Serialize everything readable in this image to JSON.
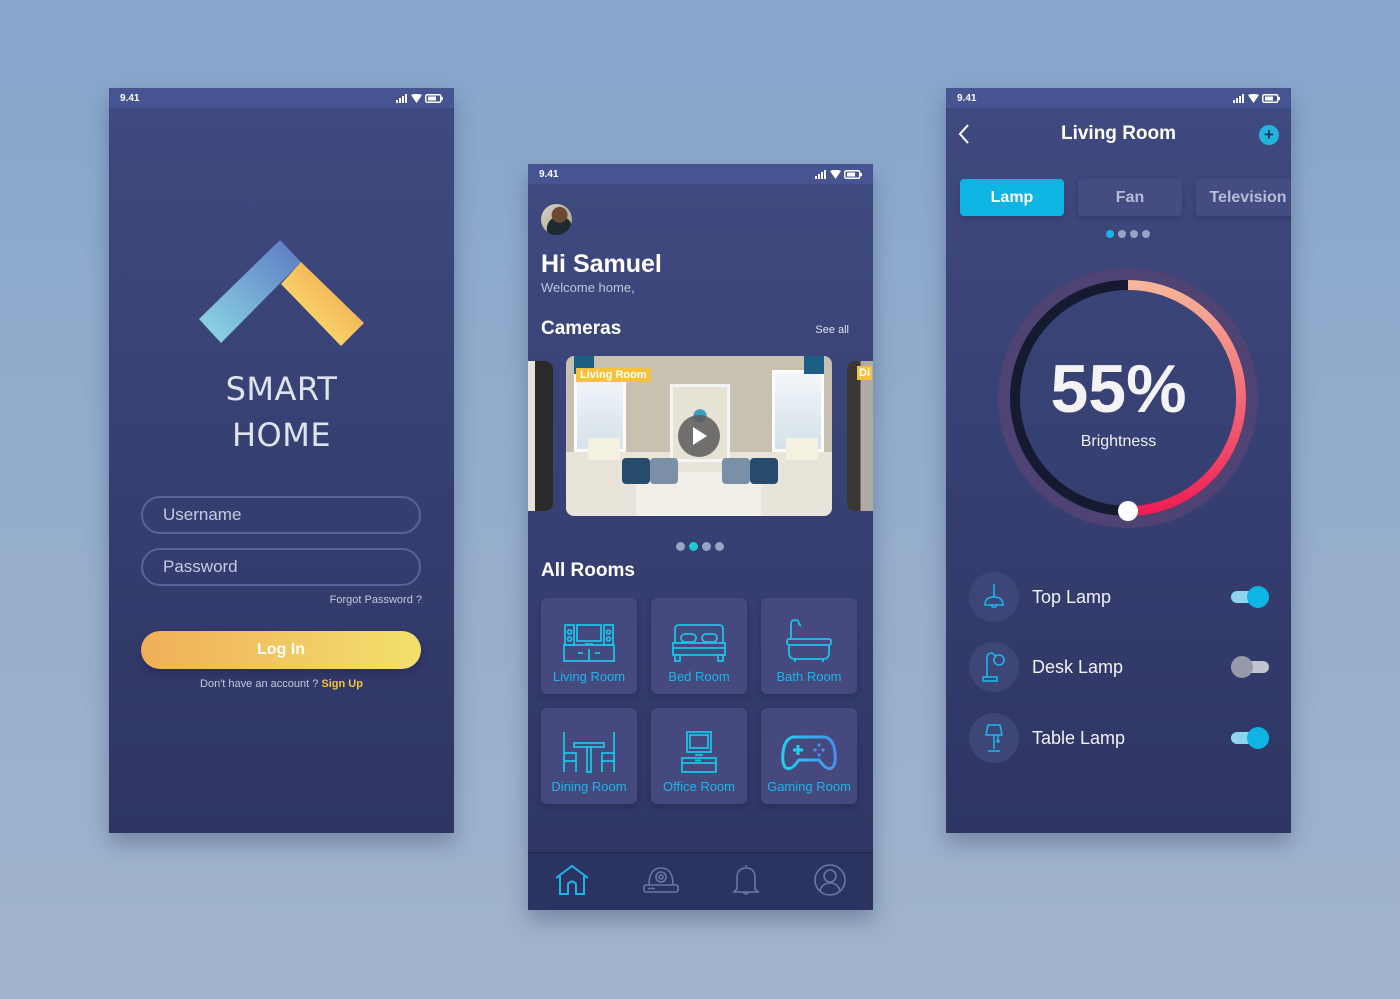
{
  "status_bar": {
    "time": "9.41"
  },
  "login": {
    "brand_line1": "SMART",
    "brand_line2": "HOME",
    "username_placeholder": "Username",
    "password_placeholder": "Password",
    "forgot_password": "Forgot Password ?",
    "login_button": "Log In",
    "no_account_text": "Don't have an account ?",
    "signup_link": "Sign Up"
  },
  "home": {
    "greeting": "Hi Samuel",
    "welcome": "Welcome home,",
    "cameras_title": "Cameras",
    "see_all": "See all",
    "cameras": [
      {
        "label": "Living Room"
      },
      {
        "label": "Di"
      }
    ],
    "camera_page": {
      "current": 2,
      "total": 4
    },
    "rooms_title": "All Rooms",
    "rooms": [
      {
        "label": "Living Room",
        "icon": "tv-unit-icon"
      },
      {
        "label": "Bed Room",
        "icon": "bed-icon"
      },
      {
        "label": "Bath Room",
        "icon": "bathtub-icon"
      },
      {
        "label": "Dining Room",
        "icon": "dining-table-icon"
      },
      {
        "label": "Office Room",
        "icon": "computer-icon"
      },
      {
        "label": "Gaming Room",
        "icon": "gamepad-icon"
      }
    ],
    "nav": [
      {
        "name": "home",
        "icon": "home-icon",
        "active": true
      },
      {
        "name": "camera",
        "icon": "security-camera-icon",
        "active": false
      },
      {
        "name": "notifications",
        "icon": "bell-icon",
        "active": false
      },
      {
        "name": "profile",
        "icon": "user-icon",
        "active": false
      }
    ]
  },
  "room": {
    "title": "Living Room",
    "tabs": [
      {
        "label": "Lamp",
        "active": true
      },
      {
        "label": "Fan",
        "active": false
      },
      {
        "label": "Television",
        "active": false
      }
    ],
    "tab_page": {
      "current": 1,
      "total": 4
    },
    "brightness_value": "55%",
    "brightness_percent": 55,
    "brightness_label": "Brightness",
    "lamps": [
      {
        "name": "Top Lamp",
        "icon": "pendant-lamp-icon",
        "on": true
      },
      {
        "name": "Desk Lamp",
        "icon": "desk-lamp-icon",
        "on": false
      },
      {
        "name": "Table Lamp",
        "icon": "table-lamp-icon",
        "on": true
      }
    ]
  },
  "colors": {
    "accent_cyan": "#0fb5e2",
    "accent_yellow": "#f6c23e",
    "room_icon": "#1cb5ea",
    "gauge_start": "#f7b59a",
    "gauge_end": "#ee1f55"
  }
}
